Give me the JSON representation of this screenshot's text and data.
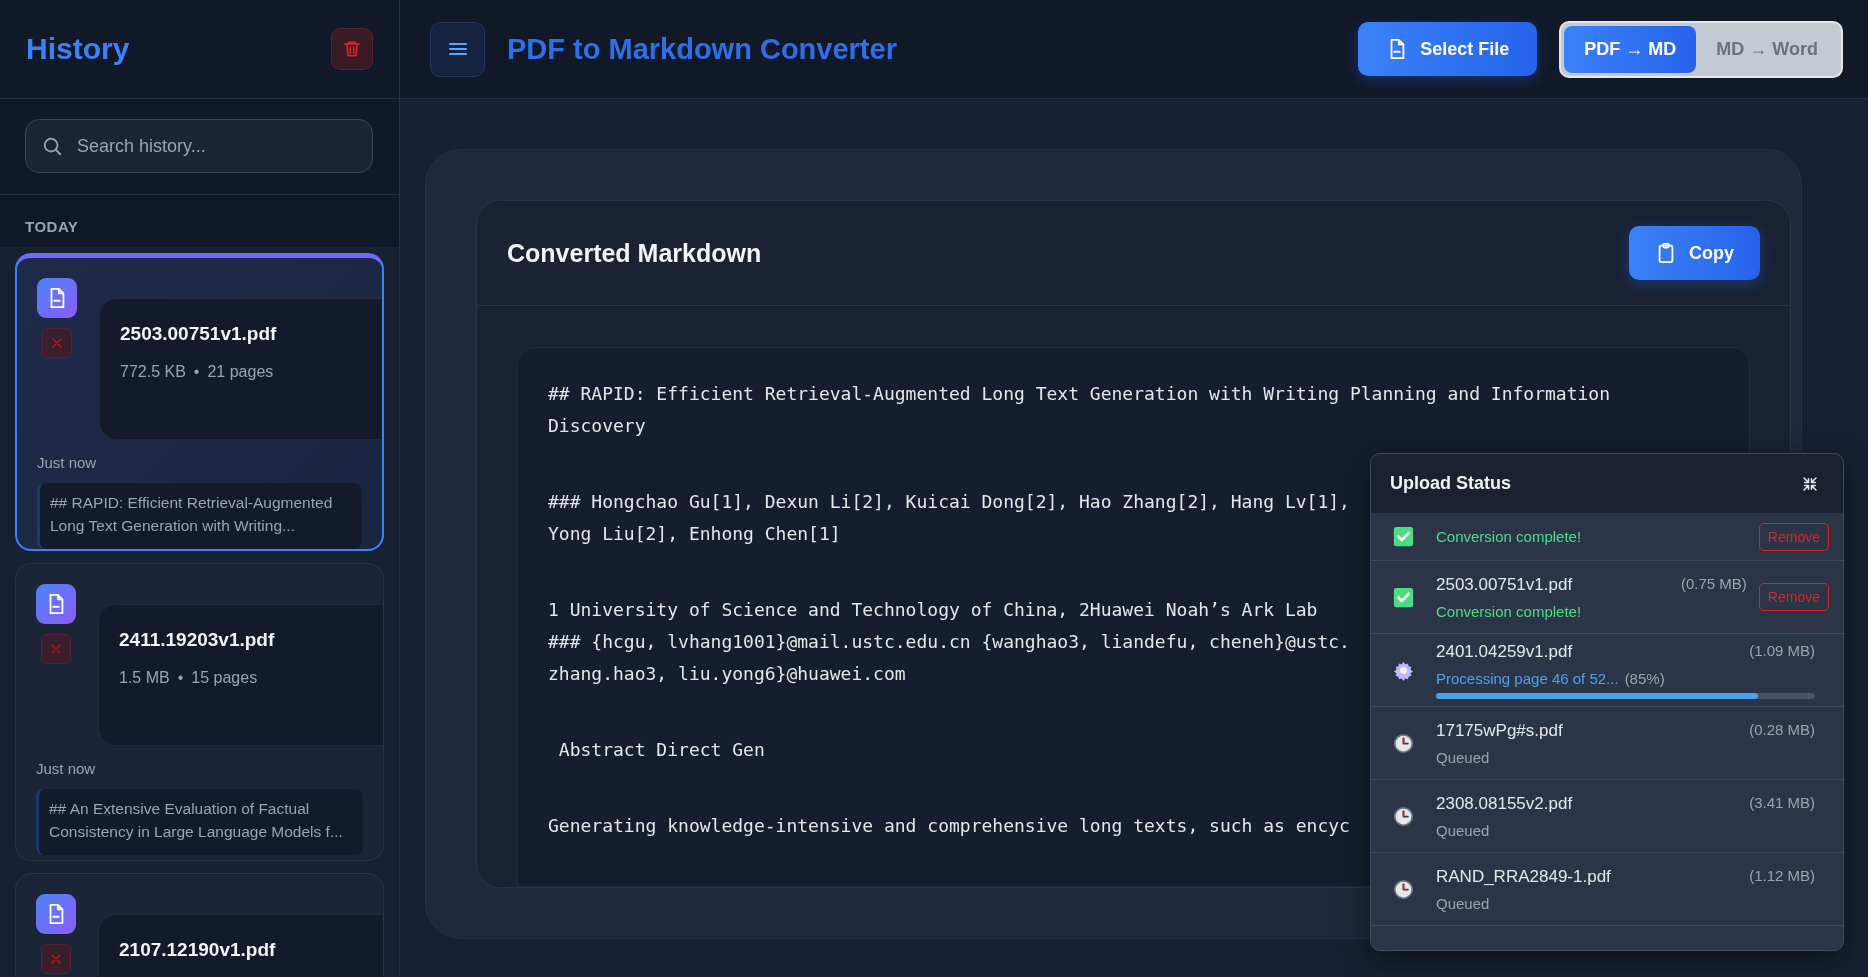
{
  "sidebar": {
    "title": "History",
    "search": {
      "placeholder": "Search history..."
    },
    "section": "TODAY",
    "items": [
      {
        "name": "2503.00751v1.pdf",
        "size": "772.5 KB",
        "separator": "•",
        "pages": "21 pages",
        "time": "Just now",
        "preview": "## RAPID: Efficient Retrieval-Augmented Long Text Generation with Writing...",
        "selected": true
      },
      {
        "name": "2411.19203v1.pdf",
        "size": "1.5 MB",
        "separator": "•",
        "pages": "15 pages",
        "time": "Just now",
        "preview": "## An Extensive Evaluation of Factual Consistency in Large Language Models f...",
        "selected": false
      },
      {
        "name": "2107.12190v1.pdf",
        "selected": false
      }
    ]
  },
  "header": {
    "title": "PDF to Markdown Converter",
    "select_button": "Select File",
    "modes": [
      {
        "label": "PDF → MD",
        "selected": true
      },
      {
        "label": "MD → Word",
        "selected": false
      }
    ]
  },
  "result": {
    "title": "Converted Markdown",
    "copy_button": "Copy",
    "paragraphs": [
      [
        "## RAPID: Efficient Retrieval-Augmented Long Text Generation with Writing Planning and Information",
        "Discovery"
      ],
      [
        "### Hongchao Gu[1], Dexun Li[2], Kuicai Dong[2], Hao Zhang[2], Hang Lv[1],",
        "Yong Liu[2], Enhong Chen[1]"
      ],
      [
        "1 University of Science and Technology of China, 2Huawei Noah’s Ark Lab",
        "### {hcgu, lvhang1001}@mail.ustc.edu.cn {wanghao3, liandefu, cheneh}@ustc.",
        "zhang.hao3, liu.yong6}@huawei.com"
      ],
      [
        " Abstract Direct Gen"
      ],
      [
        "Generating knowledge-intensive and comprehensive long texts, such as encyc"
      ]
    ]
  },
  "upload_panel": {
    "title": "Upload Status",
    "items": [
      {
        "kind": "done",
        "status": "Conversion complete!",
        "action": "Remove"
      },
      {
        "kind": "done",
        "name": "2503.00751v1.pdf",
        "size": "(0.75 MB)",
        "status": "Conversion complete!",
        "action": "Remove"
      },
      {
        "kind": "processing",
        "name": "2401.04259v1.pdf",
        "size": "(1.09 MB)",
        "status": "Processing page 46 of 52...",
        "percent": "(85%)",
        "level": 0.85
      },
      {
        "kind": "queued",
        "name": "17175wPg#s.pdf",
        "size": "(0.28 MB)",
        "status": "Queued"
      },
      {
        "kind": "queued",
        "name": "2308.08155v2.pdf",
        "size": "(3.41 MB)",
        "status": "Queued"
      },
      {
        "kind": "queued",
        "name": "RAND_RRA2849-1.pdf",
        "size": "(1.12 MB)",
        "status": "Queued"
      }
    ]
  }
}
